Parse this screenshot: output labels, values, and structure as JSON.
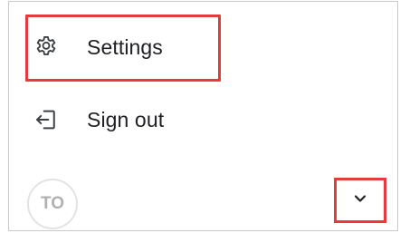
{
  "menu": {
    "items": [
      {
        "label": "Settings",
        "icon": "gear-icon",
        "highlighted": true
      },
      {
        "label": "Sign out",
        "icon": "sign-out-icon",
        "highlighted": false
      }
    ]
  },
  "footer": {
    "avatar_initials": "TO",
    "expand_icon": "chevron-down-icon",
    "expand_highlighted": true
  },
  "colors": {
    "highlight": "#e63b3b",
    "text": "#202124",
    "icon": "#3c4043",
    "avatar_text": "#b0b0b0",
    "border": "#c9c9c9"
  }
}
